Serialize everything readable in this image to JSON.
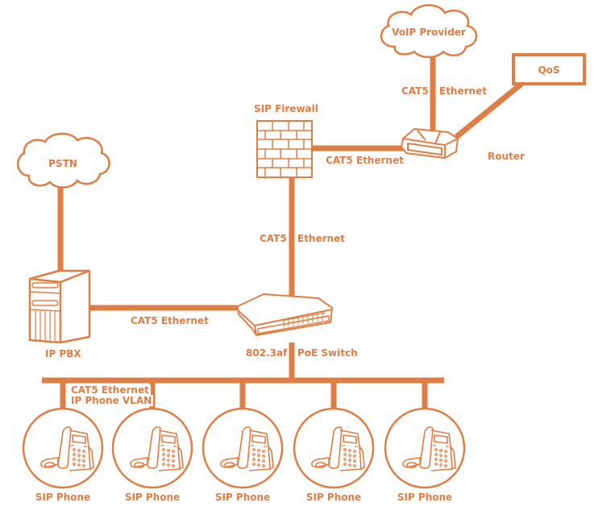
{
  "colors": {
    "accent": "#DE7E45",
    "background": "#FFFFFF"
  },
  "nodes": {
    "voip_provider": {
      "label": "VoIP Provider",
      "icon": "cloud-icon"
    },
    "qos": {
      "label": "QoS",
      "icon": "box"
    },
    "router": {
      "label": "Router",
      "icon": "router-icon"
    },
    "sip_firewall": {
      "label": "SIP Firewall",
      "icon": "firewall-icon"
    },
    "pstn": {
      "label": "PSTN",
      "icon": "cloud-icon"
    },
    "ip_pbx": {
      "label": "IP PBX",
      "icon": "server-icon"
    },
    "poe_switch": {
      "label_left": "802.3af",
      "label_right": "PoE Switch",
      "icon": "switch-icon"
    },
    "phones": [
      {
        "label": "SIP Phone",
        "icon": "phone-icon"
      },
      {
        "label": "SIP Phone",
        "icon": "phone-icon"
      },
      {
        "label": "SIP Phone",
        "icon": "phone-icon"
      },
      {
        "label": "SIP Phone",
        "icon": "phone-icon"
      },
      {
        "label": "SIP Phone",
        "icon": "phone-icon"
      }
    ]
  },
  "links": {
    "voip_router": {
      "left": "CAT5",
      "right": "Ethernet"
    },
    "firewall_router": "CAT5 Ethernet",
    "firewall_switch": {
      "left": "CAT5",
      "right": "Ethernet"
    },
    "pbx_switch": "CAT5 Ethernet",
    "phone_bus": {
      "line1": "CAT5 Ethernet",
      "line2": "IP Phone VLAN"
    }
  }
}
